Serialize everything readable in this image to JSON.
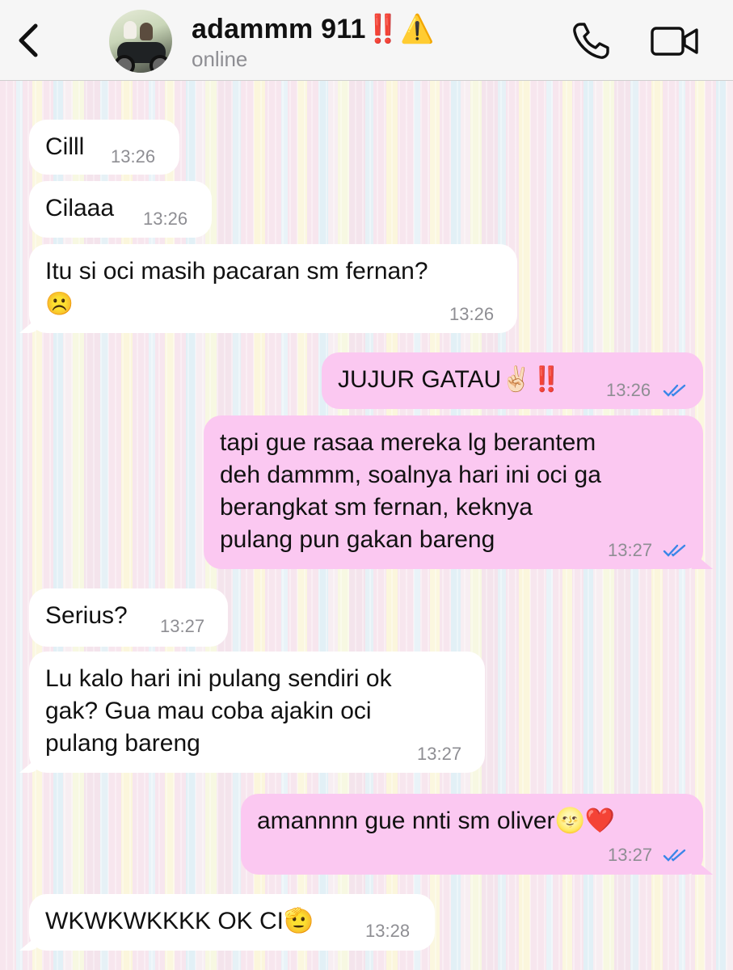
{
  "header": {
    "contact_name": "adammm 911‼️⚠️",
    "status": "online",
    "icons": [
      "back-chevron-icon",
      "avatar-photo",
      "phone-icon",
      "video-camera-icon"
    ]
  },
  "messages": [
    {
      "dir": "in",
      "text": "Cilll",
      "time": "13:26"
    },
    {
      "dir": "in",
      "text": "Cilaaa",
      "time": "13:26"
    },
    {
      "dir": "in",
      "text": "Itu si oci masih pacaran sm fernan?",
      "emoji": "☹️",
      "time": "13:26"
    },
    {
      "dir": "out",
      "text": "JUJUR GATAU✌🏻‼️",
      "time": "13:26",
      "read": true
    },
    {
      "dir": "out",
      "lines": [
        "tapi gue rasaa mereka lg berantem",
        "deh dammm, soalnya hari ini oci ga",
        "berangkat sm fernan, keknya",
        "pulang pun gakan bareng"
      ],
      "time": "13:27",
      "read": true
    },
    {
      "dir": "in",
      "text": "Serius?",
      "time": "13:27"
    },
    {
      "dir": "in",
      "lines": [
        "Lu kalo hari ini pulang sendiri ok",
        "gak? Gua mau coba ajakin oci",
        "pulang bareng"
      ],
      "time": "13:27"
    },
    {
      "dir": "out",
      "text": "amannnn gue nnti sm oliver🌝❤️",
      "time": "13:27",
      "read": true
    },
    {
      "dir": "in",
      "text": "WKWKWKKKK OK CI🫡",
      "time": "13:28"
    }
  ],
  "colors": {
    "outgoing_bubble": "#fbc8f1",
    "incoming_bubble": "#ffffff",
    "read_check": "#3a86e8",
    "header_bg": "#f6f6f6"
  }
}
